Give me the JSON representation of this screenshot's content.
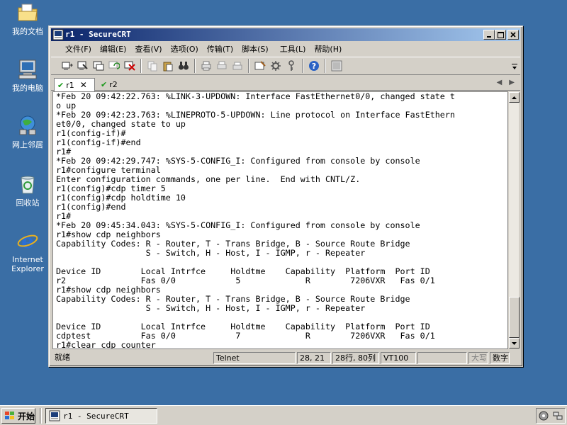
{
  "desktop": {
    "icons": [
      {
        "label": "我的文档",
        "icon": "my-documents-icon"
      },
      {
        "label": "我的电脑",
        "icon": "my-computer-icon"
      },
      {
        "label": "网上邻居",
        "icon": "network-places-icon"
      },
      {
        "label": "回收站",
        "icon": "recycle-bin-icon"
      },
      {
        "label": "Internet Explorer",
        "icon": "internet-explorer-icon"
      }
    ]
  },
  "window": {
    "title": "r1 - SecureCRT",
    "menu": [
      "文件(F)",
      "编辑(E)",
      "查看(V)",
      "选项(O)",
      "传输(T)",
      "脚本(S)",
      "工具(L)",
      "帮助(H)"
    ],
    "tabs": [
      {
        "label": "r1",
        "active": true
      },
      {
        "label": "r2",
        "active": false
      }
    ],
    "terminal_lines": [
      "*Feb 20 09:42:22.763: %LINK-3-UPDOWN: Interface FastEthernet0/0, changed state t",
      "o up",
      "*Feb 20 09:42:23.763: %LINEPROTO-5-UPDOWN: Line protocol on Interface FastEthern",
      "et0/0, changed state to up",
      "r1(config-if)#",
      "r1(config-if)#end",
      "r1#",
      "*Feb 20 09:42:29.747: %SYS-5-CONFIG_I: Configured from console by console",
      "r1#configure terminal",
      "Enter configuration commands, one per line.  End with CNTL/Z.",
      "r1(config)#cdp timer 5",
      "r1(config)#cdp holdtime 10",
      "r1(config)#end",
      "r1#",
      "*Feb 20 09:45:34.043: %SYS-5-CONFIG_I: Configured from console by console",
      "r1#show cdp neighbors",
      "Capability Codes: R - Router, T - Trans Bridge, B - Source Route Bridge",
      "                  S - Switch, H - Host, I - IGMP, r - Repeater",
      "",
      "Device ID        Local Intrfce     Holdtme    Capability  Platform  Port ID",
      "r2               Fas 0/0            5             R        7206VXR   Fas 0/1",
      "r1#show cdp neighbors",
      "Capability Codes: R - Router, T - Trans Bridge, B - Source Route Bridge",
      "                  S - Switch, H - Host, I - IGMP, r - Repeater",
      "",
      "Device ID        Local Intrfce     Holdtme    Capability  Platform  Port ID",
      "cdptest          Fas 0/0            7             R        7206VXR   Fas 0/1",
      "r1#clear cdp counter"
    ],
    "status": {
      "ready": "就绪",
      "protocol": "Telnet",
      "cursor": "28, 21",
      "size": "28行, 80列",
      "emulation": "VT100",
      "caps": "大写",
      "num": "数字"
    }
  },
  "taskbar": {
    "start_label": "开始",
    "task_label": "r1 - SecureCRT"
  },
  "colors": {
    "desktop": "#3a6ea5",
    "titlebar_start": "#0a246a",
    "titlebar_end": "#a6caf0",
    "chrome": "#d4d0c8"
  }
}
